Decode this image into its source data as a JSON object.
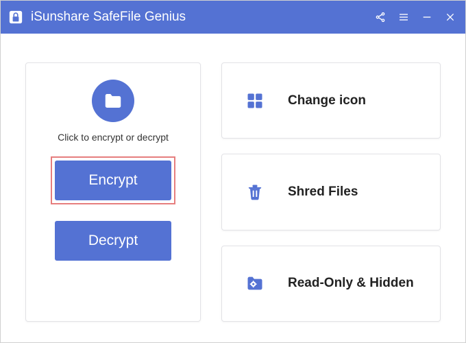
{
  "app": {
    "title": "iSunshare SafeFile Genius"
  },
  "left": {
    "hint": "Click to encrypt or decrypt",
    "encrypt_label": "Encrypt",
    "decrypt_label": "Decrypt"
  },
  "cards": {
    "change_icon": "Change icon",
    "shred_files": "Shred Files",
    "readonly_hidden": "Read-Only & Hidden"
  },
  "colors": {
    "accent": "#5472d3",
    "highlight_border": "#e67d7d"
  }
}
